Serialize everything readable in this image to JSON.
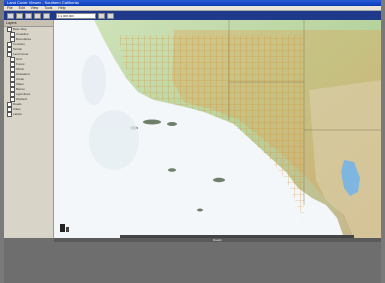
{
  "window": {
    "title": "Land Cover Viewer - Southern California",
    "titlebar_color": "#1846c8"
  },
  "menubar": {
    "items": [
      "File",
      "Edit",
      "View",
      "Tools",
      "Help"
    ]
  },
  "toolbar": {
    "scale_value": "1:1,000,000"
  },
  "sidebar": {
    "heading": "Layers",
    "items": [
      {
        "label": "Base Map",
        "sub": false
      },
      {
        "label": "Coastline",
        "sub": true
      },
      {
        "label": "Boundaries",
        "sub": true
      },
      {
        "label": "Counties",
        "sub": false
      },
      {
        "label": "Terrain",
        "sub": false
      },
      {
        "label": "Land Cover",
        "sub": false
      },
      {
        "label": "Grid",
        "sub": true
      },
      {
        "label": "Forest",
        "sub": true
      },
      {
        "label": "Shrub",
        "sub": true
      },
      {
        "label": "Grassland",
        "sub": true
      },
      {
        "label": "Urban",
        "sub": true
      },
      {
        "label": "Water",
        "sub": true
      },
      {
        "label": "Barren",
        "sub": true
      },
      {
        "label": "Agriculture",
        "sub": true
      },
      {
        "label": "Wetland",
        "sub": true
      },
      {
        "label": "Roads",
        "sub": false
      },
      {
        "label": "Cities",
        "sub": false
      },
      {
        "label": "Labels",
        "sub": false
      }
    ]
  },
  "map": {
    "ocean_color": "#f4f7f9",
    "land_color": "#b9d8a8",
    "grid_color": "#d98c2b",
    "water_color": "#7fb6e0"
  },
  "status": {
    "text": "Ready"
  }
}
